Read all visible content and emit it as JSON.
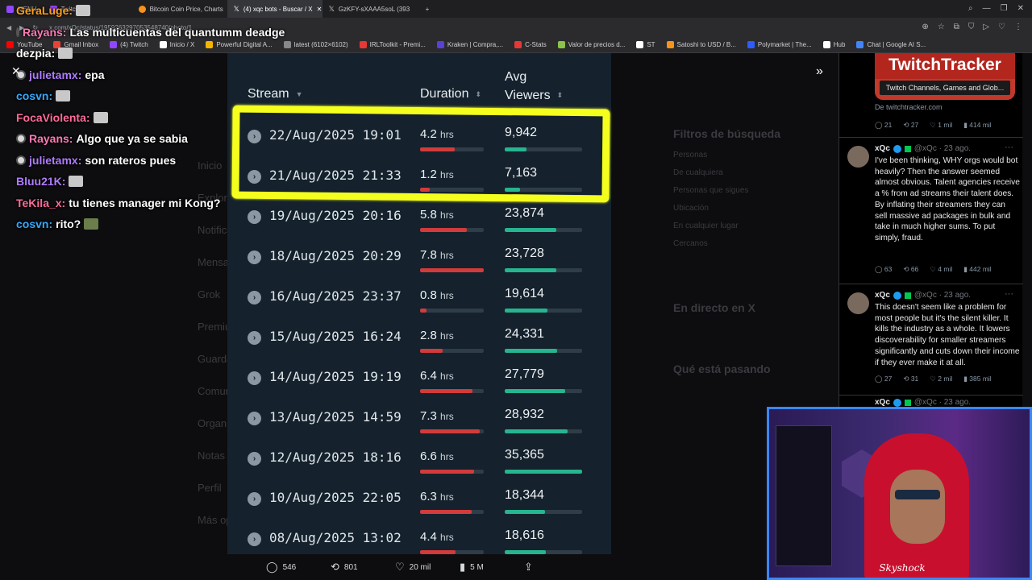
{
  "browser": {
    "tabs": [
      {
        "label": "MENU",
        "color": "#9146ff"
      },
      {
        "label": "Twitch",
        "color": "#9146ff"
      },
      {
        "label": "Bitcoin Coin Price, Charts",
        "color": "#f7931a"
      },
      {
        "label": "(4) xqc bots - Buscar / X",
        "color": "#ffffff",
        "active": true
      },
      {
        "label": "GzKFY-sXAAA5soL (393",
        "color": "#ffffff"
      }
    ],
    "url": "x.com/xQc/status/1959263297053548740/photo/1",
    "bookmarks": [
      {
        "label": "YouTube",
        "color": "#ff0000"
      },
      {
        "label": "Gmail Inbox",
        "color": "#ea4335"
      },
      {
        "label": "(4) Twitch",
        "color": "#9146ff"
      },
      {
        "label": "Inicio / X",
        "color": "#ffffff"
      },
      {
        "label": "Powerful Digital A...",
        "color": "#f5b400"
      },
      {
        "label": "latest (6102×6102)",
        "color": "#888888"
      },
      {
        "label": "IRLToolkit - Premi...",
        "color": "#e53935"
      },
      {
        "label": "Kraken | Compra,...",
        "color": "#5741d9"
      },
      {
        "label": "C-Stats",
        "color": "#e53935"
      },
      {
        "label": "Valor de precios d...",
        "color": "#8bc34a"
      },
      {
        "label": "ST",
        "color": "#ffffff"
      },
      {
        "label": "Satoshi to USD / B...",
        "color": "#f7931a"
      },
      {
        "label": "Polymarket | The...",
        "color": "#2e5cff"
      },
      {
        "label": "Hub",
        "color": "#ffffff"
      },
      {
        "label": "Chat | Google AI S...",
        "color": "#4285f4"
      }
    ]
  },
  "chat": {
    "lines": [
      {
        "user": "GeraLuge:",
        "color": "#ff9f1c",
        "text": ""
      },
      {
        "user": "Rayans:",
        "color": "#ff7ab6",
        "text": "Las multicuentas del quantumm deadge",
        "badge": true
      },
      {
        "user": "dezpia:",
        "color": "#ffffff",
        "text": ""
      },
      {
        "user": "julietamx:",
        "color": "#b07cff",
        "text": "epa",
        "badge": true
      },
      {
        "user": "cosvn:",
        "color": "#33aaff",
        "text": ""
      },
      {
        "user": "FocaViolenta:",
        "color": "#ff6b9a",
        "text": ""
      },
      {
        "user": "Rayans:",
        "color": "#ff7ab6",
        "text": "Algo que ya se sabia",
        "badge": true
      },
      {
        "user": "julietamx:",
        "color": "#b07cff",
        "text": "son rateros pues",
        "badge": true
      },
      {
        "user": "Bluu21K:",
        "color": "#b07cff",
        "text": ""
      },
      {
        "user": "TeKila_x:",
        "color": "#ff6b9a",
        "text": "tu tienes manager mi Kong?"
      },
      {
        "user": "cosvn:",
        "color": "#33aaff",
        "text": "rito?"
      }
    ]
  },
  "x_background": {
    "nav": [
      "Inicio",
      "Explorar",
      "Notificaciones",
      "Mensajes",
      "Grok",
      "Premium",
      "Guardados",
      "Comunidades",
      "Organizaciones",
      "Notas",
      "Perfil",
      "Más opciones"
    ],
    "filters_title": "Filtros de búsqueda",
    "live_title": "En directo en X",
    "happening_title": "Qué está pasando"
  },
  "table": {
    "headers": {
      "stream": "Stream",
      "duration": "Duration",
      "avg_viewers_line1": "Avg",
      "avg_viewers_line2": "Viewers"
    },
    "hours_unit": "hrs",
    "rows": [
      {
        "date": "22/Aug/2025 19:01",
        "duration": "4.2",
        "viewers": "9,942",
        "dur_frac": 0.54,
        "view_frac": 0.28
      },
      {
        "date": "21/Aug/2025 21:33",
        "duration": "1.2",
        "viewers": "7,163",
        "dur_frac": 0.15,
        "view_frac": 0.2
      },
      {
        "date": "19/Aug/2025 20:16",
        "duration": "5.8",
        "viewers": "23,874",
        "dur_frac": 0.74,
        "view_frac": 0.67
      },
      {
        "date": "18/Aug/2025 20:29",
        "duration": "7.8",
        "viewers": "23,728",
        "dur_frac": 1.0,
        "view_frac": 0.67
      },
      {
        "date": "16/Aug/2025 23:37",
        "duration": "0.8",
        "viewers": "19,614",
        "dur_frac": 0.1,
        "view_frac": 0.55
      },
      {
        "date": "15/Aug/2025 16:24",
        "duration": "2.8",
        "viewers": "24,331",
        "dur_frac": 0.36,
        "view_frac": 0.68
      },
      {
        "date": "14/Aug/2025 19:19",
        "duration": "6.4",
        "viewers": "27,779",
        "dur_frac": 0.82,
        "view_frac": 0.78
      },
      {
        "date": "13/Aug/2025 14:59",
        "duration": "7.3",
        "viewers": "28,932",
        "dur_frac": 0.94,
        "view_frac": 0.81
      },
      {
        "date": "12/Aug/2025 18:16",
        "duration": "6.6",
        "viewers": "35,365",
        "dur_frac": 0.85,
        "view_frac": 1.0
      },
      {
        "date": "10/Aug/2025 22:05",
        "duration": "6.3",
        "viewers": "18,344",
        "dur_frac": 0.81,
        "view_frac": 0.52
      },
      {
        "date": "08/Aug/2025 13:02",
        "duration": "4.4",
        "viewers": "18,616",
        "dur_frac": 0.56,
        "view_frac": 0.53
      }
    ]
  },
  "post_actions": {
    "replies": "546",
    "reposts": "801",
    "likes": "20 mil",
    "views": "5 M"
  },
  "tweets": {
    "card_title": "TwitchTracker",
    "card_subtitle": "Twitch Channels, Games and Glob...",
    "card_from": "De twitchtracker.com",
    "card_stats": [
      "21",
      "27",
      "1 mil",
      "414 mil"
    ],
    "items": [
      {
        "name": "xQc",
        "handle": "@xQc · 23 ago.",
        "text": "I've been thinking, WHY orgs would bot heavily? Then the answer seemed almost obvious. Talent agencies receive a % from ad streams their talent does. By inflating their streamers they can sell massive ad packages in bulk and take in much higher sums. To put simply, fraud.",
        "stats": [
          "63",
          "66",
          "4 mil",
          "442 mil"
        ]
      },
      {
        "name": "xQc",
        "handle": "@xQc · 23 ago.",
        "text": "This doesn't seem like a problem for most people but it's the silent killer. It kills the industry as a whole. It lowers discoverability for smaller streamers significantly and cuts down their income if they ever make it at all.",
        "stats": [
          "27",
          "31",
          "2 mil",
          "385 mil"
        ]
      },
      {
        "name": "xQc",
        "handle": "@xQc · 23 ago."
      }
    ]
  },
  "webcam": {
    "signature": "Skyshock"
  }
}
